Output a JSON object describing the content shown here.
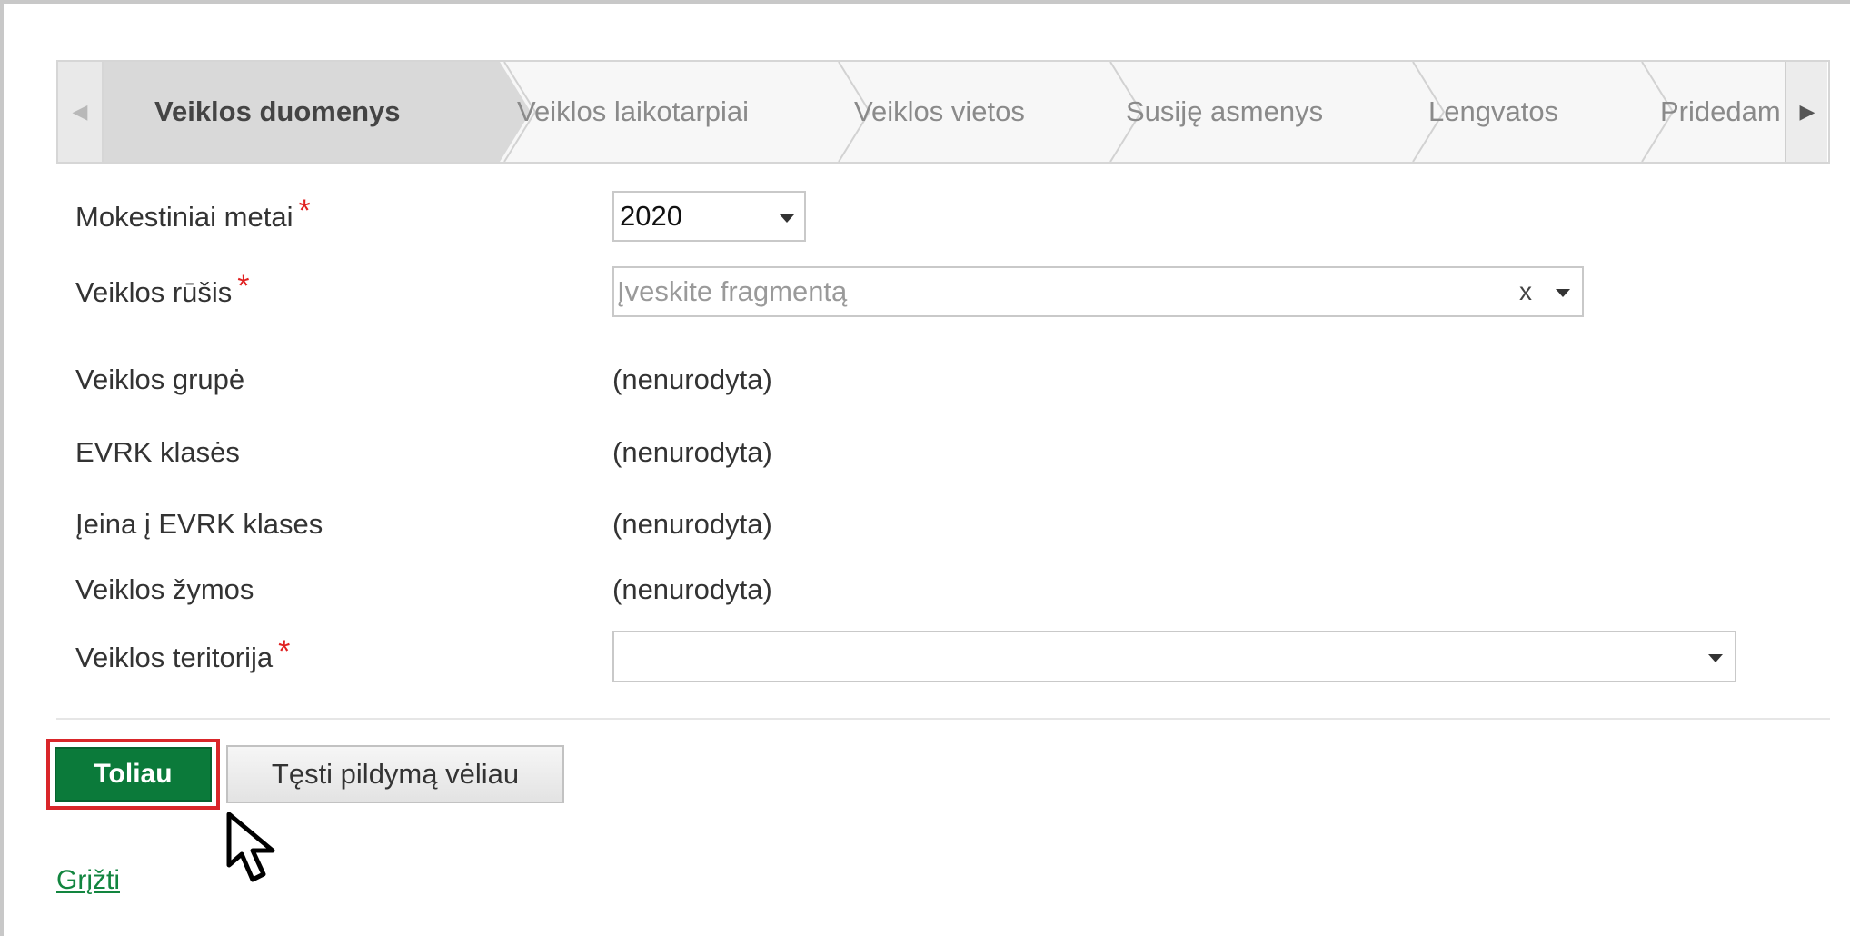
{
  "wizard": {
    "scroll_left_icon": "chevron-left-icon",
    "scroll_right_icon": "chevron-right-icon",
    "tabs": [
      {
        "label": "Veiklos duomenys",
        "active": true
      },
      {
        "label": "Veiklos laikotarpiai",
        "active": false
      },
      {
        "label": "Veiklos vietos",
        "active": false
      },
      {
        "label": "Susiję asmenys",
        "active": false
      },
      {
        "label": "Lengvatos",
        "active": false
      },
      {
        "label": "Pridedam",
        "active": false
      }
    ]
  },
  "form": {
    "required_marker": "*",
    "tax_year": {
      "label": "Mokestiniai metai",
      "value": "2020"
    },
    "activity_type": {
      "label": "Veiklos rūšis",
      "placeholder": "Įveskite fragmentą",
      "clear_symbol": "x"
    },
    "activity_group": {
      "label": "Veiklos grupė",
      "value": "(nenurodyta)"
    },
    "evrk_classes": {
      "label": "EVRK klasės",
      "value": "(nenurodyta)"
    },
    "included_evrk": {
      "label": "Įeina į EVRK klases",
      "value": "(nenurodyta)"
    },
    "activity_tags": {
      "label": "Veiklos žymos",
      "value": "(nenurodyta)"
    },
    "territory": {
      "label": "Veiklos teritorija",
      "value": ""
    }
  },
  "actions": {
    "next_label": "Toliau",
    "continue_later_label": "Tęsti pildymą vėliau",
    "back_label": "Grįžti"
  },
  "colors": {
    "primary_button": "#0b7a3a",
    "highlight_border": "#d9262a",
    "required": "#e02020",
    "link": "#12853f"
  }
}
